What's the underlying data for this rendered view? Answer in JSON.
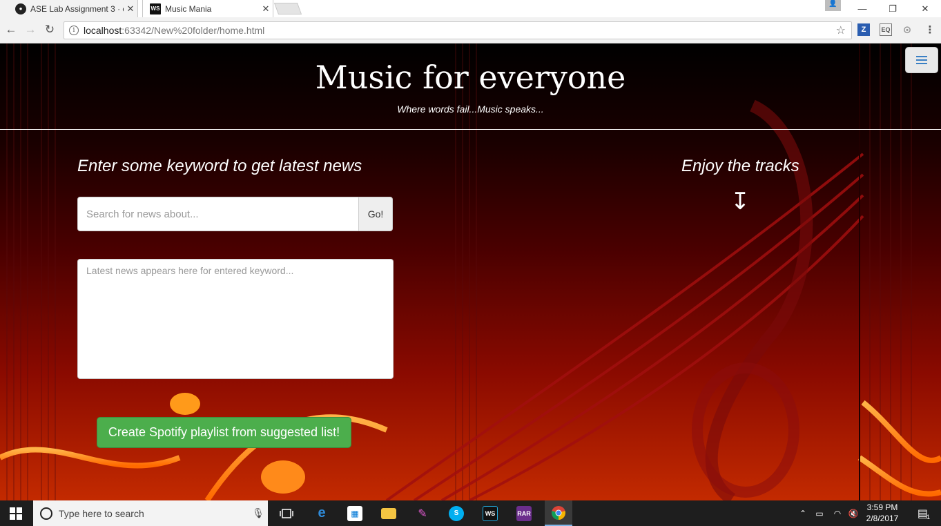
{
  "browser": {
    "tabs": [
      {
        "label": "ASE Lab Assignment 3 · c",
        "favicon": "github-icon",
        "active": false
      },
      {
        "label": "Music Mania",
        "favicon": "webstorm-icon",
        "active": true
      }
    ],
    "close_glyph": "✕",
    "address": {
      "host": "localhost",
      "path": ":63342/New%20folder/home.html"
    },
    "extensions": [
      "Z",
      "EQ",
      "⊙",
      "⋮"
    ]
  },
  "page": {
    "title": "Music for everyone",
    "tagline": "Where words fail...Music speaks...",
    "news_heading": "Enter some keyword to get latest news",
    "tracks_heading": "Enjoy the tracks",
    "arrow": "↧",
    "search": {
      "placeholder": "Search for news about...",
      "button_label": "Go!"
    },
    "news_area": {
      "placeholder": "Latest news appears here for entered keyword..."
    },
    "spotify_button": "Create Spotify playlist from suggested list!"
  },
  "taskbar": {
    "search_placeholder": "Type here to search",
    "clock_time": "3:59 PM",
    "clock_date": "2/8/2017",
    "notification_count": "1"
  },
  "colors": {
    "accent_green": "#4cae4c",
    "menu_icon": "#3a7fc4",
    "taskbar": "#1e1e1e"
  }
}
